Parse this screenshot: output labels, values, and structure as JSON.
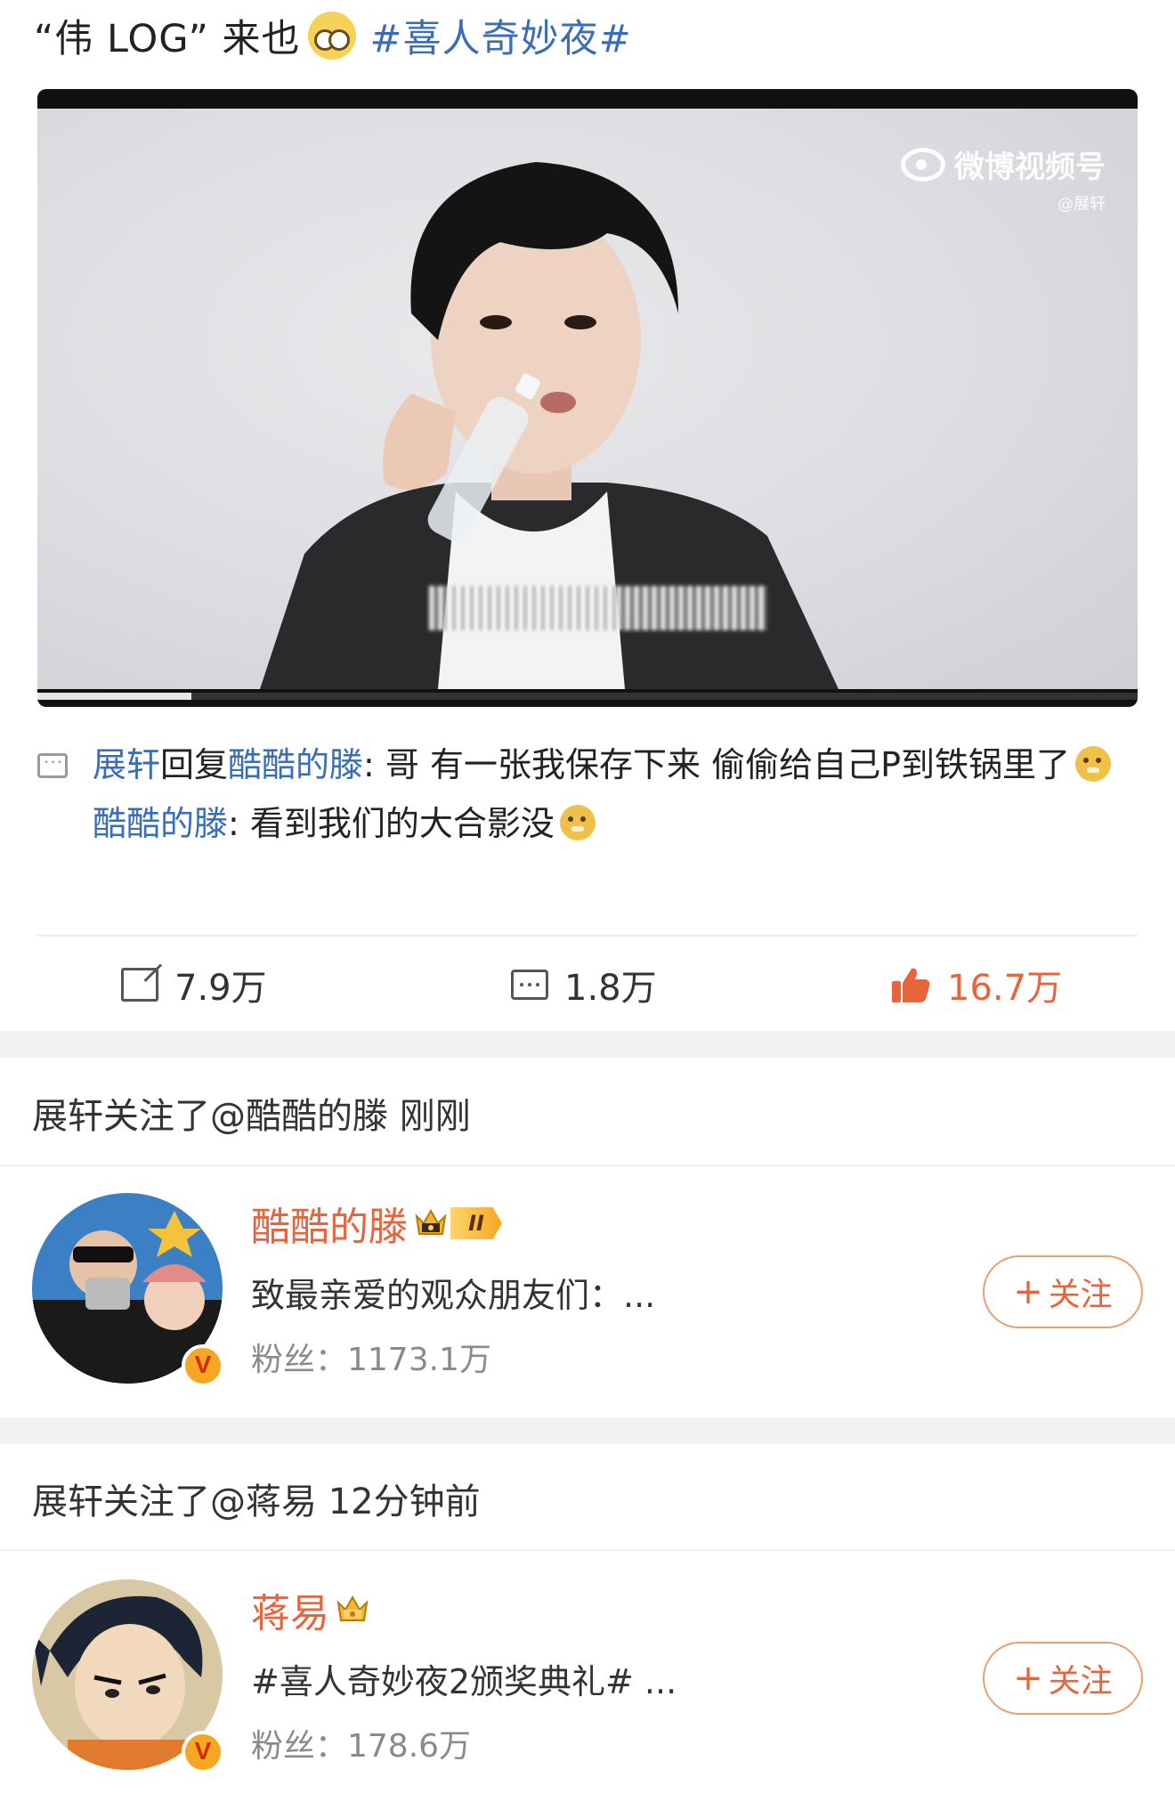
{
  "post": {
    "title_text": "“伟 LOG” 来也",
    "hashtag": "#喜人奇妙夜#"
  },
  "video": {
    "watermark_main": "微博视频号",
    "watermark_sub": "@展轩",
    "progress_fraction": 0.14
  },
  "comments": [
    {
      "user": "展轩",
      "reply_word": "回复",
      "reply_to": "酷酷的滕",
      "text": ": 哥 有一张我保存下来 偷偷给自己P到铁锅里了",
      "emoji": "doge-icon"
    },
    {
      "user": "酷酷的滕",
      "text": ": 看到我们的大合影没",
      "emoji": "doge-icon"
    }
  ],
  "actions": {
    "share_count": "7.9万",
    "comment_count": "1.8万",
    "like_count": "16.7万"
  },
  "follow_events": [
    {
      "header": "展轩关注了@酷酷的滕 刚刚",
      "name": "酷酷的滕",
      "level": "II",
      "desc": "致最亲爱的观众朋友们：...",
      "fans": "粉丝：1173.1万",
      "button": "关注"
    },
    {
      "header": "展轩关注了@蒋易 12分钟前",
      "name": "蒋易",
      "desc": "#喜人奇妙夜2颁奖典礼# ...",
      "fans": "粉丝：178.6万",
      "button": "关注"
    }
  ],
  "colors": {
    "link_blue": "#3a6db4",
    "accent_orange": "#e8643c",
    "gap_gray": "#f2f2f2"
  }
}
